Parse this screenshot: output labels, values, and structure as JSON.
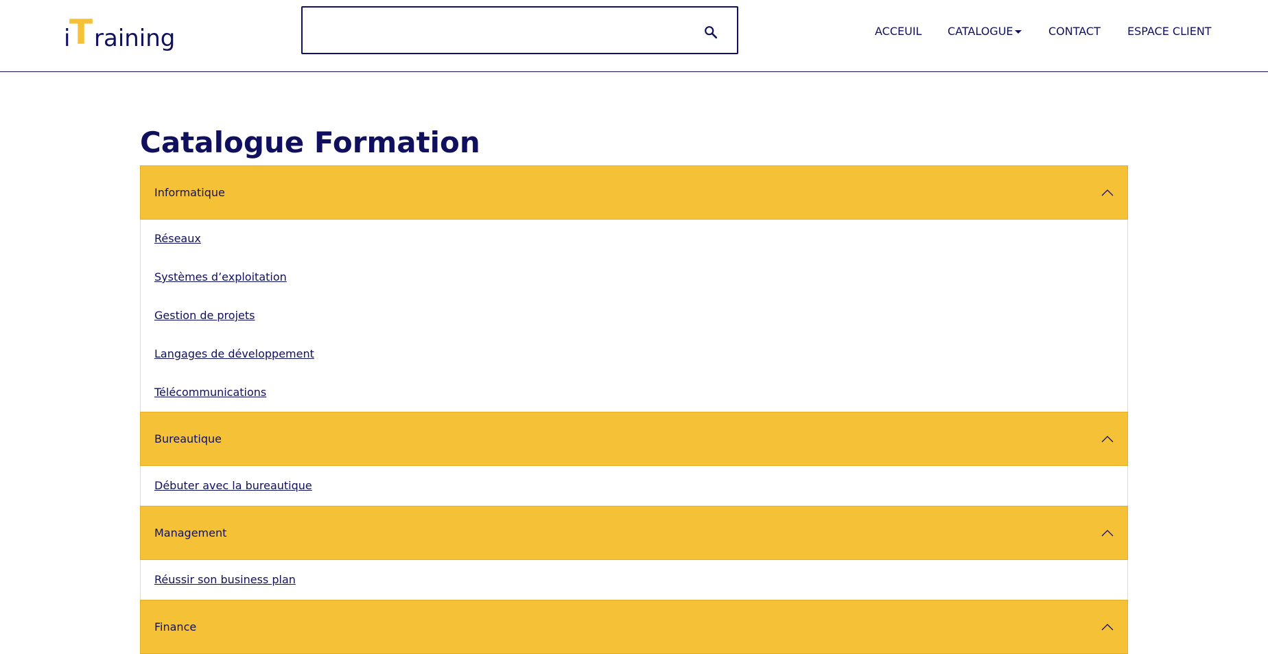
{
  "logo": {
    "i": "i",
    "t": "T",
    "rest": "raining"
  },
  "search": {
    "placeholder": "",
    "value": "",
    "icon": "search-icon"
  },
  "nav": [
    {
      "label": "ACCEUIL"
    },
    {
      "label": "CATALOGUE"
    },
    {
      "label": "CONTACT"
    },
    {
      "label": "ESPACE CLIENT"
    }
  ],
  "page_title": "Catalogue Formation",
  "accordion": [
    {
      "label": "Informatique",
      "links": [
        "Réseaux",
        "Systèmes d’exploitation",
        "Gestion de projets",
        "Langages de développement",
        "Télécommunications"
      ]
    },
    {
      "label": "Bureautique",
      "links": [
        "Débuter avec la bureautique"
      ]
    },
    {
      "label": "Management",
      "links": [
        "Réussir son business plan"
      ]
    },
    {
      "label": "Finance",
      "links": []
    }
  ],
  "colors": {
    "primary": "#10105e",
    "accent": "#f5c237"
  }
}
